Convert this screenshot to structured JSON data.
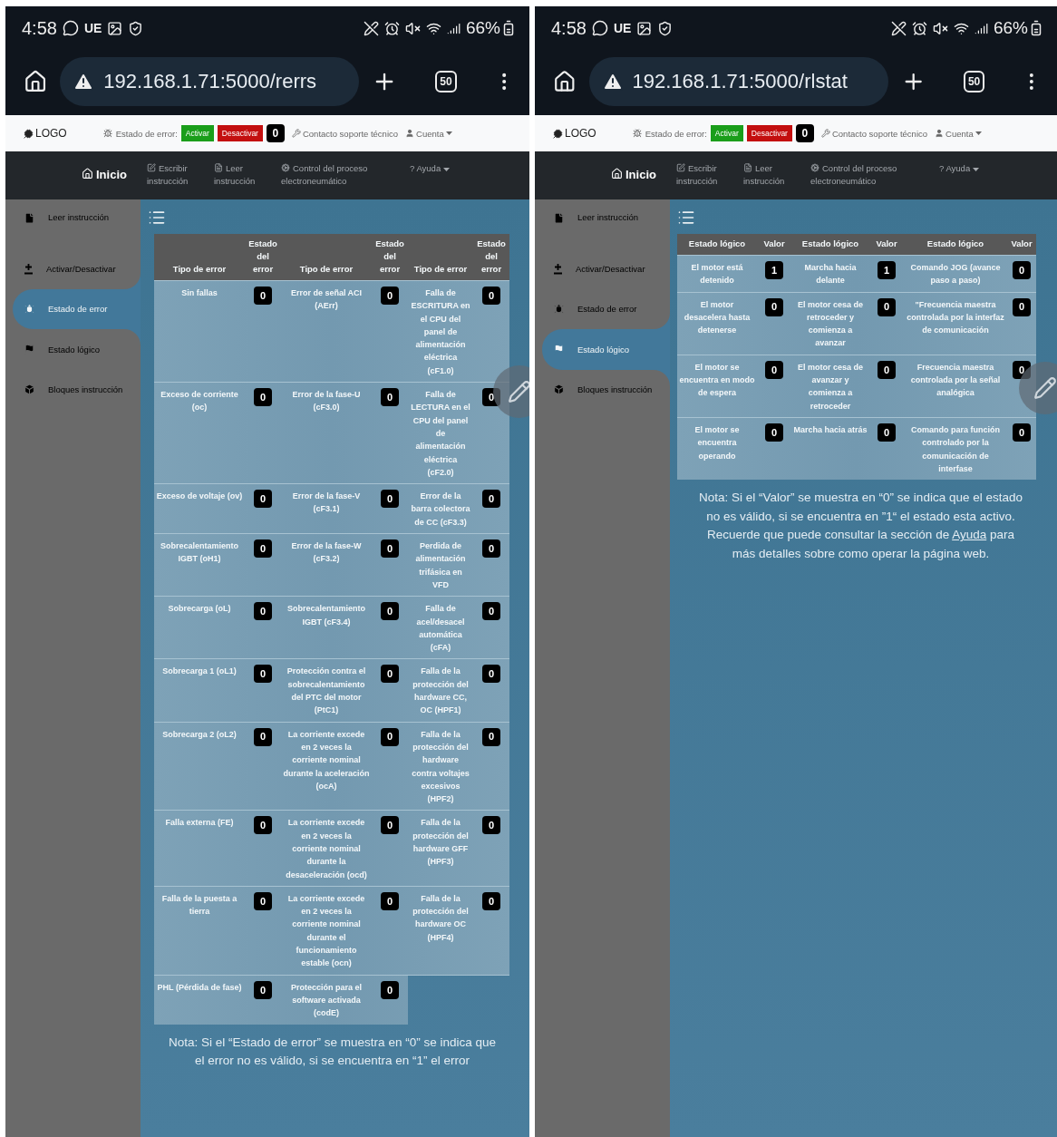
{
  "phones": [
    {
      "status_bar": {
        "time": "4:58",
        "carrier": "UE",
        "battery": "66%"
      },
      "browser": {
        "url": "192.168.1.71:5000/rerrs",
        "tab_count": "50"
      },
      "header": {
        "logo": "LOGO",
        "error_label": "Estado de error:",
        "activate": "Activar",
        "deactivate": "Desactivar",
        "error_value": "0",
        "support": "Contacto soporte técnico",
        "account": "Cuenta"
      },
      "main_nav": [
        {
          "label": "Inicio",
          "selected": true
        },
        {
          "label": "Escribir instrucción",
          "selected": false
        },
        {
          "label": "Leer instrucción",
          "selected": false
        },
        {
          "label": "Control del proceso electroneumático",
          "selected": false
        },
        {
          "label": "? Ayuda",
          "selected": false
        }
      ],
      "sidebar": [
        {
          "label": "Leer instrucción",
          "selected": false
        },
        {
          "label": "Activar/Desactivar",
          "selected": false
        },
        {
          "label": "Estado de error",
          "selected": true
        },
        {
          "label": "Estado lógico",
          "selected": false
        },
        {
          "label": "Bloques instrucción",
          "selected": false
        }
      ],
      "table": {
        "kind": "errors",
        "columns": [
          "Tipo de error",
          "Estado del error",
          "Tipo de error",
          "Estado del error",
          "Tipo de error",
          "Estado del error"
        ],
        "rows": [
          [
            "Sin fallas",
            "0",
            "Error de señal ACI (AErr)",
            "0",
            "Falla de ESCRITURA en el CPU del panel de alimentación eléctrica (cF1.0)",
            "0"
          ],
          [
            "Exceso de corriente (oc)",
            "0",
            "Error de la fase-U (cF3.0)",
            "0",
            "Falla de LECTURA en el CPU del panel de alimentación eléctrica (cF2.0)",
            "0"
          ],
          [
            "Exceso de voltaje (ov)",
            "0",
            "Error de la fase-V (cF3.1)",
            "0",
            "Error de la barra colectora de CC (cF3.3)",
            "0"
          ],
          [
            "Sobrecalentamiento IGBT (oH1)",
            "0",
            "Error de la fase-W (cF3.2)",
            "0",
            "Perdida de alimentación trifásica en VFD",
            "0"
          ],
          [
            "Sobrecarga (oL)",
            "0",
            "Sobrecalentamiento IGBT (cF3.4)",
            "0",
            "Falla de acel/desacel automática (cFA)",
            "0"
          ],
          [
            "Sobrecarga 1 (oL1)",
            "0",
            "Protección contra el sobrecalentamiento del PTC del motor (PtC1)",
            "0",
            "Falla de la protección del hardware CC, OC (HPF1)",
            "0"
          ],
          [
            "Sobrecarga 2 (oL2)",
            "0",
            "La corriente excede en 2 veces la corriente nominal durante la aceleración (ocA)",
            "0",
            "Falla de la protección del hardware contra voltajes excesivos (HPF2)",
            "0"
          ],
          [
            "Falla externa (FE)",
            "0",
            "La corriente excede en 2 veces la corriente nominal durante la desaceleración (ocd)",
            "0",
            "Falla de la protección del hardware GFF (HPF3)",
            "0"
          ],
          [
            "Falla de la puesta a tierra",
            "0",
            "La corriente excede en 2 veces la corriente nominal durante el funcionamiento estable (ocn)",
            "0",
            "Falla de la protección del hardware OC (HPF4)",
            "0"
          ],
          [
            "PHL (Pérdida de fase)",
            "0",
            "Protección para el software activada (codE)",
            "0"
          ]
        ]
      },
      "note": {
        "text": "Nota: Si el “Estado de error” se muestra en “0” se indica que el error no es válido, si se encuentra en “1” el error"
      }
    },
    {
      "status_bar": {
        "time": "4:58",
        "carrier": "UE",
        "battery": "66%"
      },
      "browser": {
        "url": "192.168.1.71:5000/rlstat",
        "tab_count": "50"
      },
      "header": {
        "logo": "LOGO",
        "error_label": "Estado de error:",
        "activate": "Activar",
        "deactivate": "Desactivar",
        "error_value": "0",
        "support": "Contacto soporte técnico",
        "account": "Cuenta"
      },
      "main_nav": [
        {
          "label": "Inicio",
          "selected": true
        },
        {
          "label": "Escribir instrucción",
          "selected": false
        },
        {
          "label": "Leer instrucción",
          "selected": false
        },
        {
          "label": "Control del proceso electroneumático",
          "selected": false
        },
        {
          "label": "? Ayuda",
          "selected": false
        }
      ],
      "sidebar": [
        {
          "label": "Leer instrucción",
          "selected": false
        },
        {
          "label": "Activar/Desactivar",
          "selected": false
        },
        {
          "label": "Estado de error",
          "selected": false
        },
        {
          "label": "Estado lógico",
          "selected": true
        },
        {
          "label": "Bloques instrucción",
          "selected": false
        }
      ],
      "table": {
        "kind": "logic",
        "columns": [
          "Estado lógico",
          "Valor",
          "Estado lógico",
          "Valor",
          "Estado lógico",
          "Valor"
        ],
        "rows": [
          [
            "El motor está detenido",
            "1",
            "Marcha hacia delante",
            "1",
            "Comando JOG (avance paso a paso)",
            "0"
          ],
          [
            "El motor desacelera hasta detenerse",
            "0",
            "El motor cesa de retroceder y comienza a avanzar",
            "0",
            "\"Frecuencia maestra controlada por la interfaz de comunicación",
            "0"
          ],
          [
            "El motor se encuentra en modo de espera",
            "0",
            "El motor cesa de avanzar y comienza a retroceder",
            "0",
            "Frecuencia maestra controlada por la señal analógica",
            "0"
          ],
          [
            "El motor se encuentra operando",
            "0",
            "Marcha hacia atrás",
            "0",
            "Comando para función controlado por la comunicación de interfase",
            "0"
          ]
        ]
      },
      "note": {
        "text": "Nota: Si el “Valor” se muestra en “0” se indica que el estado no es válido, si se encuentra en ”1“ el estado esta activo. Recuerde que puede consultar la sección de",
        "link": "Ayuda",
        "after": "para más detalles sobre como operar la página web."
      }
    }
  ]
}
